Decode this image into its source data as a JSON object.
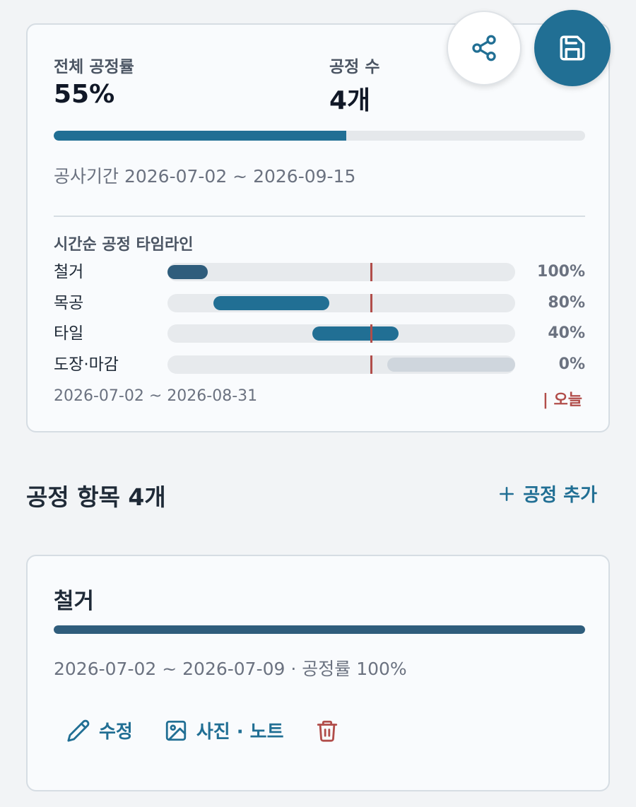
{
  "summary": {
    "overall_label": "전체 공정률",
    "overall_value": "55%",
    "overall_fraction": 0.55,
    "count_label": "공정 수",
    "count_value": "4개",
    "period": "공사기간 2026-07-02 ~ 2026-09-15"
  },
  "timeline": {
    "title": "시간순 공정 타임라인",
    "range": "2026-07-02 ~ 2026-08-31",
    "today_label": "| 오늘",
    "rows": [
      {
        "label": "철거",
        "percent": "100%",
        "color": "#2f5d7c"
      },
      {
        "label": "목공",
        "percent": "80%",
        "color": "#216f94"
      },
      {
        "label": "타일",
        "percent": "40%",
        "color": "#216f94"
      },
      {
        "label": "도장·마감",
        "percent": "0%",
        "color": "#cfd6dd"
      }
    ]
  },
  "fabs": {
    "share_icon": "share-icon",
    "save_icon": "save-icon"
  },
  "section": {
    "title": "공정 항목 4개",
    "add_label": "공정 추가"
  },
  "item": {
    "title": "철거",
    "progress_fraction": 1.0,
    "meta": "2026-07-02 ~ 2026-07-09 · 공정률 100%",
    "edit_label": "수정",
    "media_label": "사진 · 노트"
  },
  "colors": {
    "accent": "#216f94",
    "danger": "#b14d4a",
    "dark_bar": "#2f5d7c"
  }
}
